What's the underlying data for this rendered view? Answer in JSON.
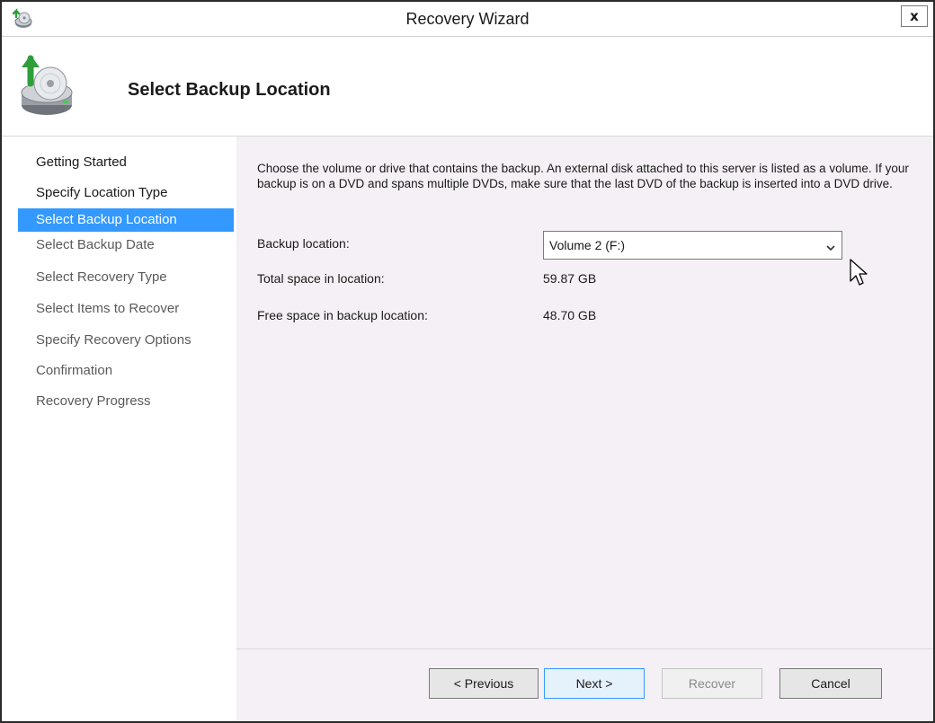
{
  "window": {
    "title": "Recovery Wizard",
    "close_label": "x"
  },
  "header": {
    "title": "Select Backup Location"
  },
  "sidebar": {
    "items": [
      {
        "label": "Getting Started",
        "state": "done"
      },
      {
        "label": "Specify Location Type",
        "state": "done"
      },
      {
        "label": "Select Backup Location",
        "state": "active"
      },
      {
        "label": "Select Backup Date",
        "state": "pending"
      },
      {
        "label": "Select Recovery Type",
        "state": "pending"
      },
      {
        "label": "Select Items to Recover",
        "state": "pending"
      },
      {
        "label": "Specify Recovery Options",
        "state": "pending"
      },
      {
        "label": "Confirmation",
        "state": "pending"
      },
      {
        "label": "Recovery Progress",
        "state": "pending"
      }
    ]
  },
  "content": {
    "description": "Choose the volume or drive that contains the backup. An external disk attached to this server is listed as a volume. If your backup is on a DVD and spans multiple DVDs, make sure that the last DVD of the backup is inserted into a DVD drive.",
    "backup_location": {
      "label": "Backup location:",
      "value": "Volume 2 (F:)"
    },
    "total_space": {
      "label": "Total space in location:",
      "value": "59.87 GB"
    },
    "free_space": {
      "label": "Free space in backup location:",
      "value": "48.70 GB"
    }
  },
  "buttons": {
    "previous": "< Previous",
    "next": "Next >",
    "recover": "Recover",
    "cancel": "Cancel"
  },
  "colors": {
    "selection": "#3399ff",
    "content_bg": "#f5f0f5",
    "primary_border": "#3399ff"
  }
}
